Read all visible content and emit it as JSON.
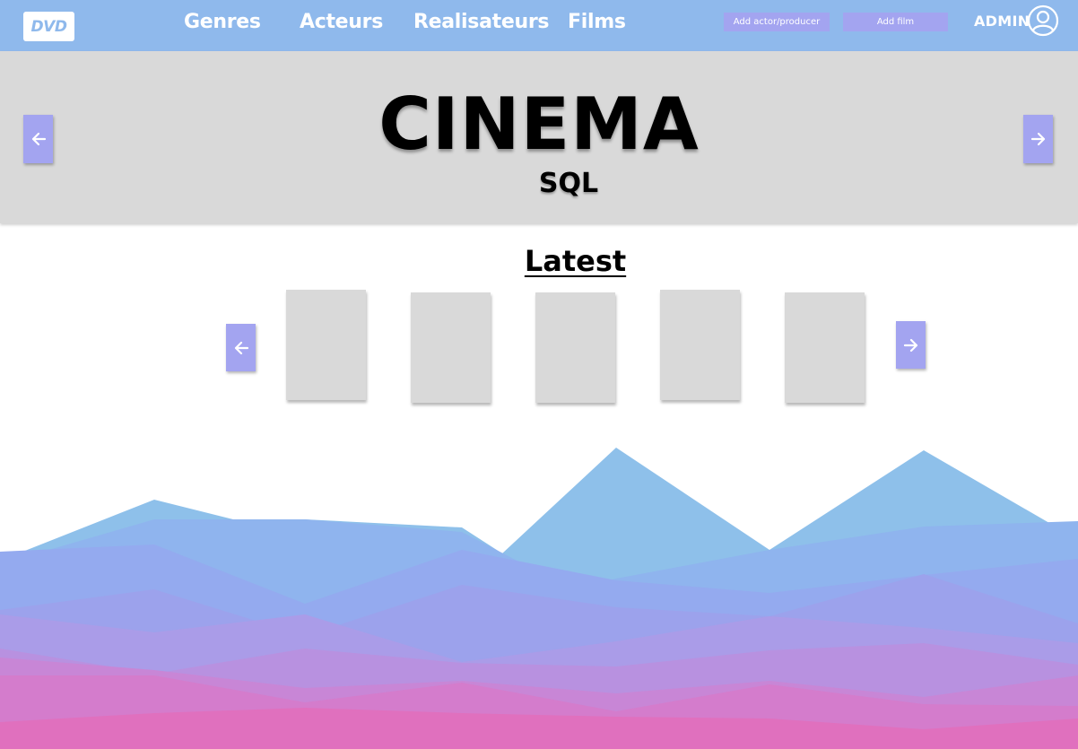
{
  "brand": {
    "logo_text": "DVD"
  },
  "nav": {
    "items": [
      {
        "label": "Genres"
      },
      {
        "label": "Acteurs"
      },
      {
        "label": "Realisateurs"
      },
      {
        "label": "Films"
      }
    ],
    "add_actor_label": "Add actor/producer",
    "add_film_label": "Add film",
    "admin_label": "ADMIN"
  },
  "hero": {
    "title": "CINEMA",
    "subtitle": "SQL",
    "prev_icon": "arrow-left-icon",
    "next_icon": "arrow-right-icon"
  },
  "latest": {
    "title": "Latest",
    "posters": [
      {
        "name": "poster-1"
      },
      {
        "name": "poster-2"
      },
      {
        "name": "poster-3"
      },
      {
        "name": "poster-4"
      },
      {
        "name": "poster-5"
      }
    ],
    "prev_icon": "arrow-left-icon",
    "next_icon": "arrow-right-icon"
  },
  "colors": {
    "nav_background": "#8fb9ec",
    "accent_button": "#a3a4f0",
    "hero_background": "#d9d9d9",
    "poster_placeholder": "#d9d9d9",
    "mountain_top": "#8ec0ea",
    "mountain_bottom": "#e070be"
  }
}
